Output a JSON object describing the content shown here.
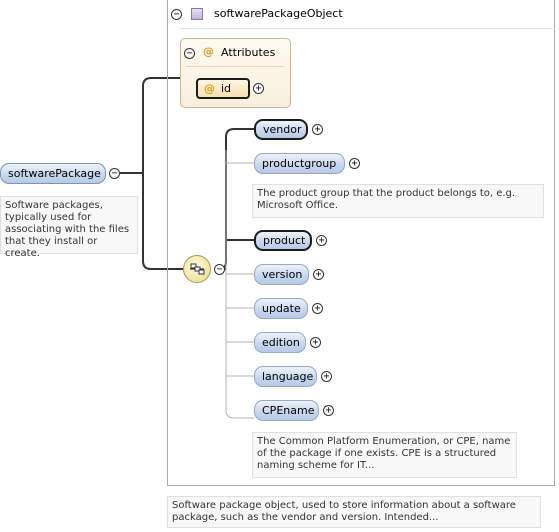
{
  "root": {
    "name": "softwarePackage",
    "annotation": [
      "Software packages,",
      "typically used for",
      "associating with the files",
      "that they install or create."
    ]
  },
  "type": {
    "name": "softwarePackageObject",
    "annotation": [
      "Software package object, used to store information about a software",
      "package, such as the vendor and version. Intended..."
    ]
  },
  "attributes": {
    "label": "Attributes",
    "items": [
      {
        "name": "id"
      }
    ]
  },
  "children": [
    {
      "name": "vendor",
      "required": true
    },
    {
      "name": "productgroup",
      "required": false
    },
    {
      "name": "product",
      "required": true
    },
    {
      "name": "version",
      "required": false
    },
    {
      "name": "update",
      "required": false
    },
    {
      "name": "edition",
      "required": false
    },
    {
      "name": "language",
      "required": false
    },
    {
      "name": "CPEname",
      "required": false
    }
  ],
  "child_annotations": {
    "productgroup": [
      "The product group that the product belongs to, e.g.",
      "Microsoft Office."
    ],
    "CPEname": [
      "The Common Platform Enumeration, or CPE, name",
      "of the package if one exists. CPE is a structured",
      "naming scheme for IT..."
    ]
  },
  "symbols": {
    "expand": "+",
    "collapse": "−",
    "attribute": "@",
    "sequence_icon": "sequence-compositor-icon",
    "type_icon": "complex-type-icon"
  },
  "colors": {
    "element_fill": "#c9d8ee",
    "attribute_fill": "#f4dfae",
    "attribute_marker": "#d89a25",
    "type_square": "#c3b4dc",
    "connector": "#333333"
  }
}
